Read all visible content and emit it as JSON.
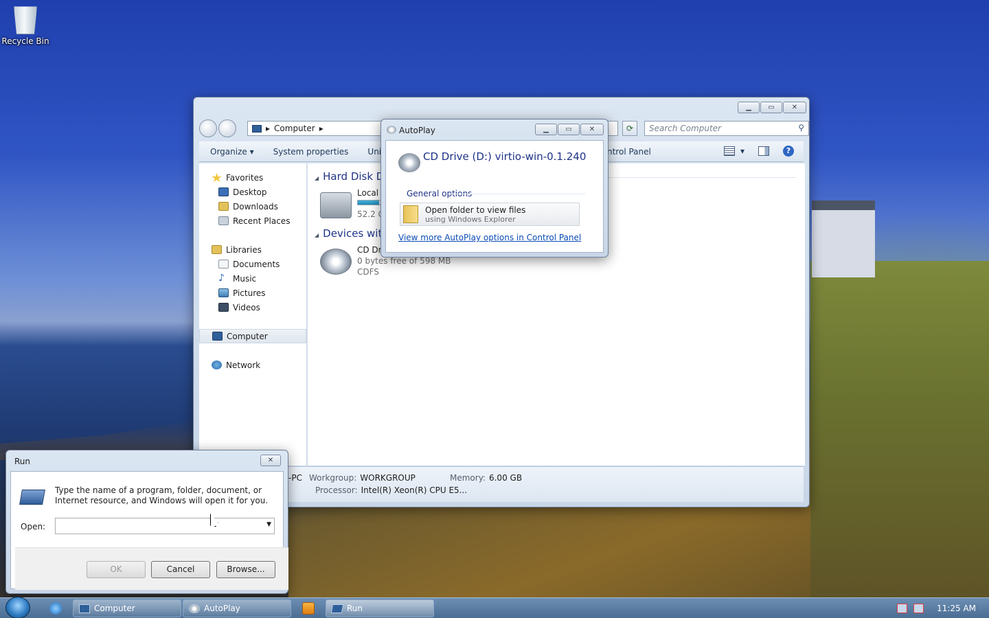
{
  "desktop": {
    "recycle_bin": "Recycle Bin"
  },
  "explorer": {
    "address": "Computer",
    "search_placeholder": "Search Computer",
    "commands": [
      "Organize",
      "System properties",
      "Uninst"
    ],
    "command_right": "ntrol Panel",
    "nav": {
      "favorites": "Favorites",
      "desktop": "Desktop",
      "downloads": "Downloads",
      "recent": "Recent Places",
      "libraries": "Libraries",
      "documents": "Documents",
      "music": "Music",
      "pictures": "Pictures",
      "videos": "Videos",
      "computer": "Computer",
      "network": "Network"
    },
    "groups": {
      "hdd": "Hard Disk Dr",
      "removable": "Devices with"
    },
    "drives": {
      "local_name": "Local D",
      "local_free": "52.2 GI",
      "local_fill": 0.9,
      "cd_name": "CD Dri",
      "cd_free": "0 bytes free of 598 MB",
      "cd_fs": "CDFS"
    },
    "details": {
      "pc_suffix": "-PC",
      "workgroup_label": "Workgroup:",
      "workgroup_value": "WORKGROUP",
      "memory_label": "Memory:",
      "memory_value": "6.00 GB",
      "processor_label": "Processor:",
      "processor_value": "Intel(R) Xeon(R) CPU E5..."
    }
  },
  "autoplay": {
    "title": "AutoPlay",
    "drive_title": "CD Drive (D:) virtio-win-0.1.240",
    "section": "General options",
    "option_line1": "Open folder to view files",
    "option_line2": "using Windows Explorer",
    "link": "View more AutoPlay options in Control Panel"
  },
  "run": {
    "title": "Run",
    "description": "Type the name of a program, folder, document, or Internet resource, and Windows will open it for you.",
    "open_label": "Open:",
    "open_value": "",
    "ok": "OK",
    "cancel": "Cancel",
    "browse": "Browse..."
  },
  "taskbar": {
    "computer": "Computer",
    "autoplay": "AutoPlay",
    "run": "Run",
    "clock": "11:25 AM"
  },
  "colors": {
    "link": "#0a4bb4",
    "heading": "#1e3287"
  }
}
